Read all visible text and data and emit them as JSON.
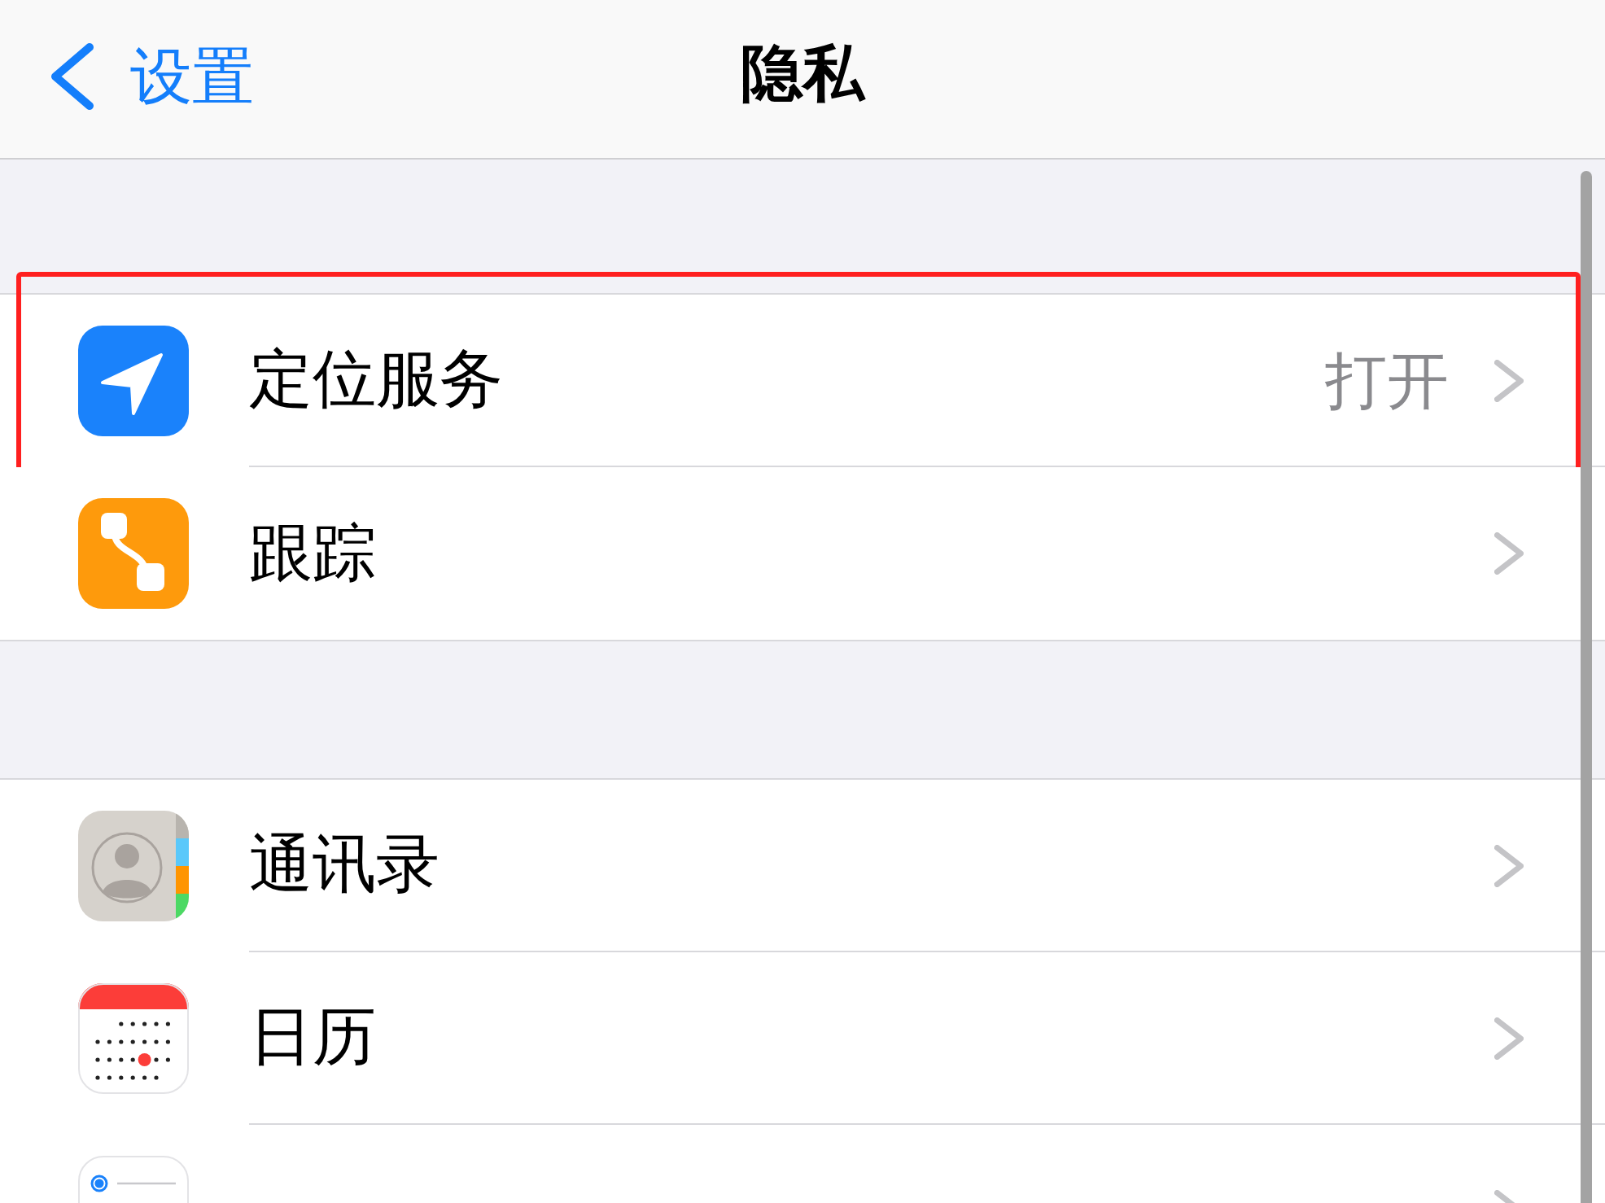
{
  "nav_bar": {
    "back_label": "设置",
    "title": "隐私"
  },
  "groups": [
    {
      "rows": [
        {
          "kind": "location",
          "label": "定位服务",
          "value": "打开",
          "highlighted": true
        },
        {
          "kind": "tracking",
          "label": "跟踪",
          "highlighted": false
        }
      ]
    },
    {
      "rows": [
        {
          "kind": "contacts",
          "label": "通讯录",
          "highlighted": false
        },
        {
          "kind": "calendar",
          "label": "日历",
          "highlighted": false
        },
        {
          "kind": "reminders",
          "highlighted": false
        }
      ]
    }
  ]
}
